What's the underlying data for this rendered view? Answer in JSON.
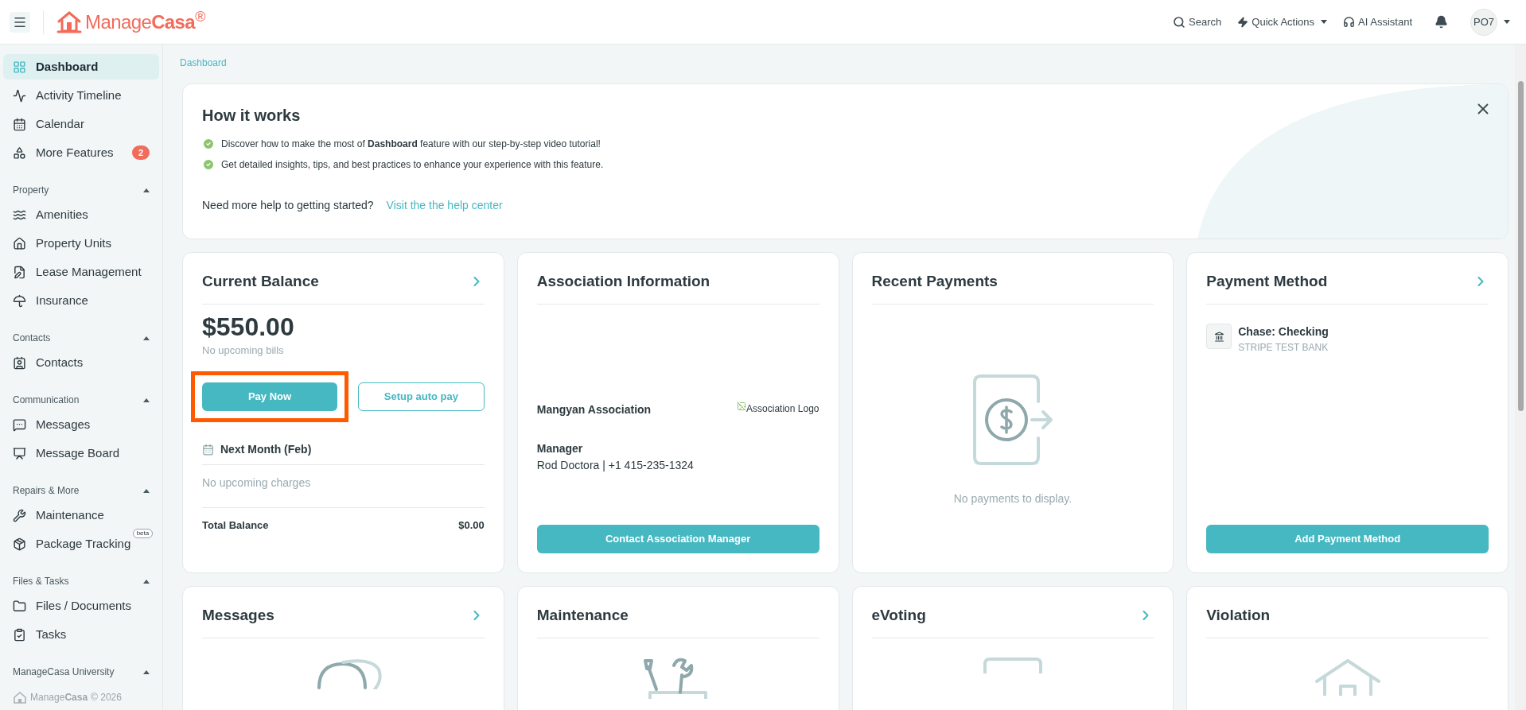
{
  "header": {
    "logo": "Manage**Casa**$^{®}$",
    "search": "Search",
    "quick_actions": "Quick Actions",
    "ai_assistant": "AI Assistant",
    "avatar": "PO7"
  },
  "sidebar": {
    "top_items": [
      {
        "label": "Dashboard",
        "selected": true
      },
      {
        "label": "Activity Timeline",
        "selected": false
      },
      {
        "label": "Calendar",
        "selected": false
      },
      {
        "label": "More Features",
        "selected": false,
        "badge": "2"
      }
    ],
    "sections": [
      {
        "title": "Property",
        "expanded": true,
        "items": [
          {
            "label": "Amenities",
            "selected": false
          },
          {
            "label": "Property Units",
            "selected": false
          },
          {
            "label": "Lease Management",
            "selected": false
          },
          {
            "label": "Insurance",
            "selected": false
          }
        ]
      },
      {
        "title": "Contacts",
        "expanded": true,
        "items": [
          {
            "label": "Contacts",
            "selected": false
          }
        ]
      },
      {
        "title": "Communication",
        "expanded": true,
        "items": [
          {
            "label": "Messages",
            "selected": false
          },
          {
            "label": "Message Board",
            "selected": false
          }
        ]
      },
      {
        "title": "Repairs & More",
        "expanded": true,
        "items": [
          {
            "label": "Maintenance",
            "selected": false
          },
          {
            "label": "Package Tracking",
            "selected": false,
            "tag": "beta"
          }
        ]
      },
      {
        "title": "Files & Tasks",
        "expanded": true,
        "items": [
          {
            "label": "Files / Documents",
            "selected": false
          },
          {
            "label": "Tasks",
            "selected": false
          }
        ]
      },
      {
        "title": "ManageCasa University",
        "expanded": true
      }
    ],
    "footer": {
      "brand": "Manage**Casa**",
      "copyright": "© 2026"
    }
  },
  "breadcrumb": "Dashboard",
  "how_it_works": {
    "title": "How it works",
    "points": [
      "Discover how to make the most of **Dashboard** feature with our step-by-step video tutorial!",
      "Get detailed insights, tips, and best practices to enhance your experience with this feature."
    ],
    "help_prompt": "Need more help to getting started?",
    "help_link": "Visit the the help center"
  },
  "cards": [
    {
      "kind": "balance",
      "title": "Current Balance",
      "link": true,
      "amount": "$550.00",
      "note": "No upcoming bills",
      "pay_button": "Pay Now",
      "pay_highlighted": true,
      "autopay_button": "Setup auto pay",
      "period": "Next Month (Feb)",
      "period_note": "No upcoming charges",
      "total_label": "Total Balance",
      "total_value": "$0.00"
    },
    {
      "kind": "association",
      "title": "Association Information",
      "link": false,
      "name": "Mangyan Association",
      "logo_alt": "Association Logo",
      "manager_label": "Manager",
      "manager": "Rod Doctora | +1 415-235-1324",
      "button": "Contact Association Manager"
    },
    {
      "kind": "payments",
      "title": "Recent Payments",
      "link": false,
      "empty": "No payments to display."
    },
    {
      "kind": "payment_method",
      "title": "Payment Method",
      "link": true,
      "method": "Chase: Checking",
      "bank": "STRIPE TEST BANK",
      "button": "Add Payment Method"
    },
    {
      "kind": "messages",
      "title": "Messages",
      "link": true
    },
    {
      "kind": "maintenance",
      "title": "Maintenance",
      "link": false
    },
    {
      "kind": "evoting",
      "title": "eVoting",
      "link": true
    },
    {
      "kind": "violation",
      "title": "Violation",
      "link": false
    }
  ]
}
